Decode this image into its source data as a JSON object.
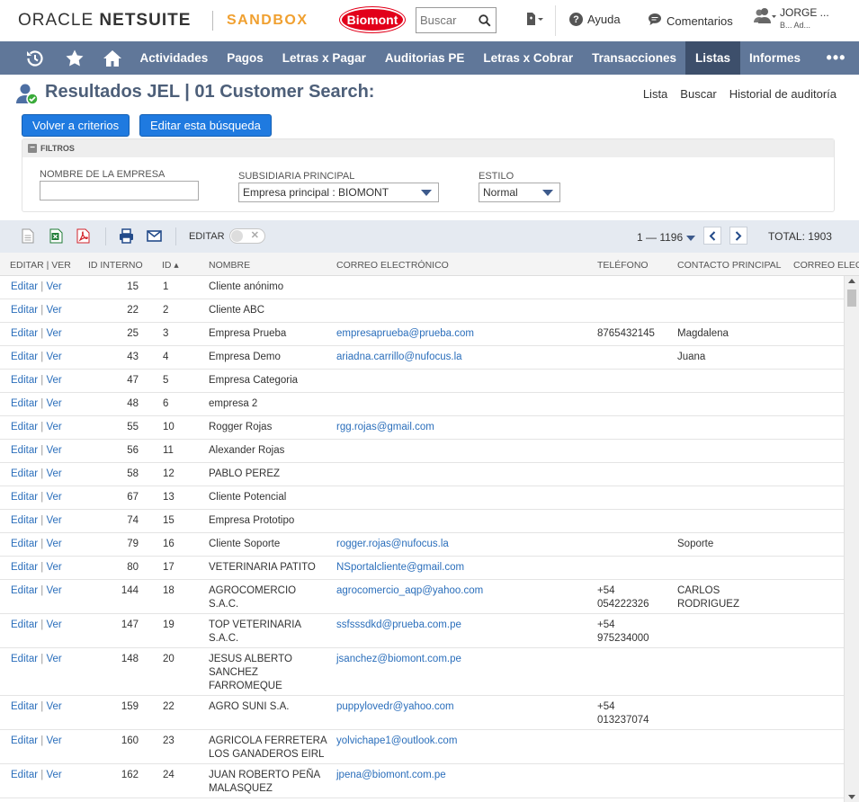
{
  "header": {
    "logo_oracle": "ORACLE",
    "logo_netsuite": "NETSUITE",
    "environment": "SANDBOX",
    "brand": "Biomont",
    "search_placeholder": "Buscar",
    "help": "Ayuda",
    "feedback": "Comentarios",
    "user_name": "JORGE ...",
    "user_sub": "B...   Ad..."
  },
  "nav": {
    "items": [
      "Actividades",
      "Pagos",
      "Letras x Pagar",
      "Auditorias PE",
      "Letras x Cobrar",
      "Transacciones",
      "Listas",
      "Informes"
    ],
    "active": "Listas",
    "more": "•••"
  },
  "page": {
    "title": "Resultados JEL | 01 Customer Search:",
    "links": [
      "Lista",
      "Buscar",
      "Historial de auditoría"
    ],
    "btn_back": "Volver a criterios",
    "btn_edit": "Editar esta búsqueda"
  },
  "filters": {
    "header": "FILTROS",
    "company_label": "NOMBRE DE LA EMPRESA",
    "company_value": "",
    "subsidiary_label": "SUBSIDIARIA PRINCIPAL",
    "subsidiary_value": "Empresa principal : BIOMONT",
    "style_label": "ESTILO",
    "style_value": "Normal"
  },
  "toolbar": {
    "edit_label": "EDITAR",
    "range": "1 — 1196",
    "total": "TOTAL: 1903"
  },
  "columns": [
    "EDITAR | VER",
    "ID INTERNO",
    "ID ▴",
    "NOMBRE",
    "CORREO ELECTRÓNICO",
    "TELÉFONO",
    "CONTACTO PRINCIPAL",
    "CORREO ELECTR"
  ],
  "row_edit": "Editar",
  "row_view": "Ver",
  "rows": [
    {
      "internal": "15",
      "id": "1",
      "name": "Cliente anónimo",
      "email": "",
      "phone": "",
      "contact": ""
    },
    {
      "internal": "22",
      "id": "2",
      "name": "Cliente ABC",
      "email": "",
      "phone": "",
      "contact": ""
    },
    {
      "internal": "25",
      "id": "3",
      "name": "Empresa Prueba",
      "email": "empresaprueba@prueba.com",
      "phone": "8765432145",
      "contact": "Magdalena"
    },
    {
      "internal": "43",
      "id": "4",
      "name": "Empresa Demo",
      "email": "ariadna.carrillo@nufocus.la",
      "phone": "",
      "contact": "Juana"
    },
    {
      "internal": "47",
      "id": "5",
      "name": "Empresa Categoria",
      "email": "",
      "phone": "",
      "contact": ""
    },
    {
      "internal": "48",
      "id": "6",
      "name": "empresa 2",
      "email": "",
      "phone": "",
      "contact": ""
    },
    {
      "internal": "55",
      "id": "10",
      "name": "Rogger Rojas",
      "email": "rgg.rojas@gmail.com",
      "phone": "",
      "contact": ""
    },
    {
      "internal": "56",
      "id": "11",
      "name": "Alexander Rojas",
      "email": "",
      "phone": "",
      "contact": ""
    },
    {
      "internal": "58",
      "id": "12",
      "name": "PABLO PEREZ",
      "email": "",
      "phone": "",
      "contact": ""
    },
    {
      "internal": "67",
      "id": "13",
      "name": "Cliente Potencial",
      "email": "",
      "phone": "",
      "contact": ""
    },
    {
      "internal": "74",
      "id": "15",
      "name": "Empresa Prototipo",
      "email": "",
      "phone": "",
      "contact": ""
    },
    {
      "internal": "79",
      "id": "16",
      "name": "Cliente Soporte",
      "email": "rogger.rojas@nufocus.la",
      "phone": "",
      "contact": "Soporte"
    },
    {
      "internal": "80",
      "id": "17",
      "name": "VETERINARIA PATITO",
      "email": "NSportalcliente@gmail.com",
      "phone": "",
      "contact": ""
    },
    {
      "internal": "144",
      "id": "18",
      "name": "AGROCOMERCIO\nS.A.C.",
      "email": "agrocomercio_aqp@yahoo.com",
      "phone": "+54\n054222326",
      "contact": "CARLOS\nRODRIGUEZ"
    },
    {
      "internal": "147",
      "id": "19",
      "name": "TOP VETERINARIA\nS.A.C.",
      "email": "ssfsssdkd@prueba.com.pe",
      "phone": "+54\n975234000",
      "contact": ""
    },
    {
      "internal": "148",
      "id": "20",
      "name": "JESUS ALBERTO\nSANCHEZ\nFARROMEQUE",
      "email": "jsanchez@biomont.com.pe",
      "phone": "",
      "contact": ""
    },
    {
      "internal": "159",
      "id": "22",
      "name": "AGRO SUNI S.A.",
      "email": "puppylovedr@yahoo.com",
      "phone": "+54\n013237074",
      "contact": ""
    },
    {
      "internal": "160",
      "id": "23",
      "name": "AGRICOLA FERRETERA\nLOS GANADEROS EIRL",
      "email": "yolvichape1@outlook.com",
      "phone": "",
      "contact": ""
    },
    {
      "internal": "162",
      "id": "24",
      "name": "JUAN ROBERTO PEÑA\nMALASQUEZ",
      "email": "jpena@biomont.com.pe",
      "phone": "",
      "contact": ""
    }
  ],
  "colors": {
    "nav_bg": "#607799",
    "nav_active": "#3d4f6b",
    "button": "#1f7ae0",
    "link": "#2a6ebb",
    "sandbox": "#f0a030",
    "brand_red": "#e2001a"
  }
}
